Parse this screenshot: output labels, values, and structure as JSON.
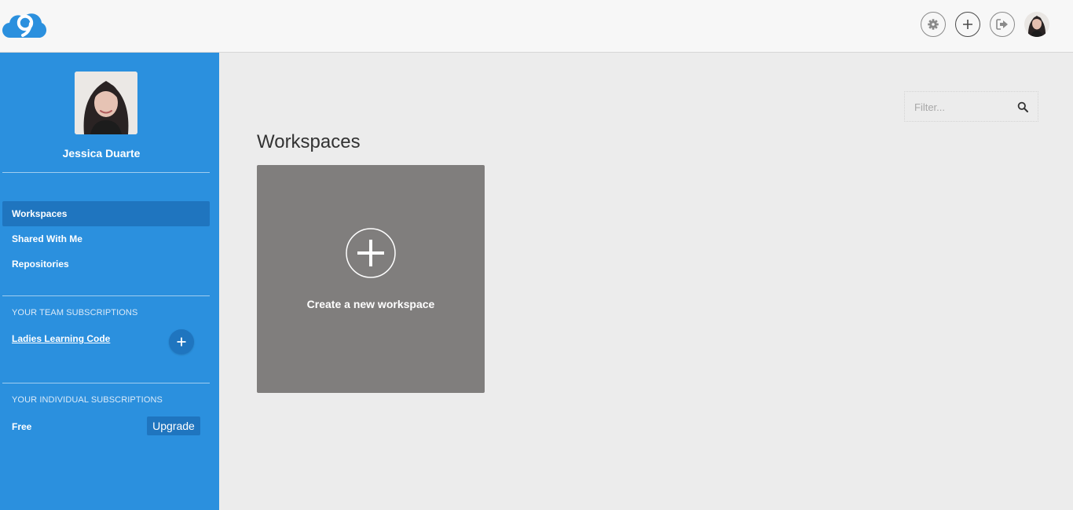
{
  "header": {
    "logo_icon": "cloud9-logo-icon",
    "icons": [
      "settings-icon",
      "plus-icon",
      "sign-out-icon",
      "avatar"
    ]
  },
  "sidebar": {
    "user_name": "Jessica Duarte",
    "nav_items": [
      {
        "label": "Workspaces",
        "active": true
      },
      {
        "label": "Shared With Me",
        "active": false
      },
      {
        "label": "Repositories",
        "active": false
      }
    ],
    "team_section_title": "YOUR TEAM SUBSCRIPTIONS",
    "team_name": "Ladies Learning Code",
    "individual_section_title": "YOUR INDIVIDUAL SUBSCRIPTIONS",
    "plan": "Free",
    "upgrade_label": "Upgrade"
  },
  "main": {
    "title": "Workspaces",
    "filter_placeholder": "Filter...",
    "new_workspace_label": "Create a new workspace"
  },
  "colors": {
    "sidebar_bg": "#2b90de",
    "sidebar_active": "#1f75bf",
    "card_bg": "#807e7d",
    "page_bg": "#ececec"
  }
}
